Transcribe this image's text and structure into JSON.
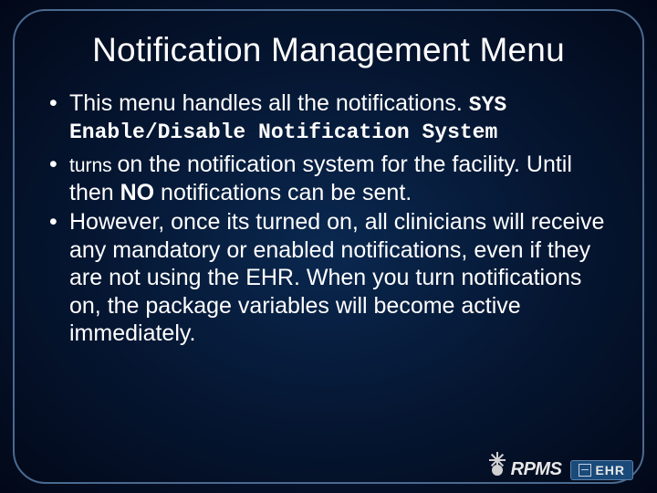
{
  "title": "Notification Management Menu",
  "bullets": {
    "b1_text": "This menu handles all the notifications.",
    "b1_sys": "SYS",
    "b1_mono_line": "Enable/Disable Notification System",
    "b2_lead": "turns ",
    "b2_rest_a": "on the notification system for the facility.  Until then ",
    "b2_bold": "NO",
    "b2_rest_b": " notifications can be sent.",
    "b3": "However, once its turned on, all clinicians will receive any mandatory or enabled notifications, even if they are not using the EHR.  When you turn notifications on, the package variables will become active immediately."
  },
  "logo": {
    "rpms": "RPMS",
    "ehr": "EHR"
  }
}
